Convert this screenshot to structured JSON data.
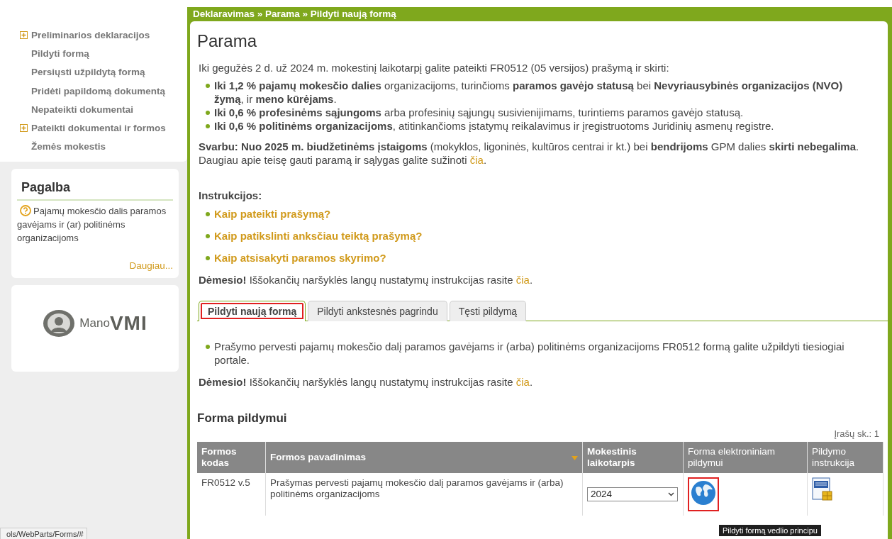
{
  "sidebar": {
    "menu": [
      {
        "label": "Preliminarios deklaracijos",
        "expandable": true
      },
      {
        "label": "Pildyti formą",
        "expandable": false
      },
      {
        "label": "Persiųsti užpildytą formą",
        "expandable": false
      },
      {
        "label": "Pridėti papildomą dokumentą",
        "expandable": false
      },
      {
        "label": "Nepateikti dokumentai",
        "expandable": false
      },
      {
        "label": "Pateikti dokumentai ir formos",
        "expandable": true
      },
      {
        "label": "Žemės mokestis",
        "expandable": false
      }
    ],
    "help": {
      "title": "Pagalba",
      "text": "Pajamų mokesčio dalis paramos gavėjams ir (ar) politinėms organizacijoms",
      "link": "Daugiau..."
    },
    "logo": {
      "word1": "Mano",
      "word2": "VMI"
    }
  },
  "breadcrumb": "Deklaravimas » Parama » Pildyti naują formą",
  "title": "Parama",
  "intro": "Iki gegužės 2 d. už 2024 m. mokestinį laikotarpį galite pateikti FR0512 (05 versijos) prašymą ir skirti:",
  "bullets": [
    "**Iki 1,2 % pajamų mokesčio dalies** organizacijoms, turinčioms **paramos gavėjo statusą** bei **Nevyriausybinės organizacijos (NVO) žymą**, ir **meno kūrėjams**.",
    "**Iki 0,6 % profesinėms sąjungoms** arba profesinių sąjungų susivienijimams, turintiems paramos gavėjo statusą.",
    "**Iki 0,6 % politinėms organizacijoms**, atitinkančioms įstatymų reikalavimus ir įregistruotoms Juridinių asmenų registre."
  ],
  "important": "**Svarbu: Nuo 2025 m. biudžetinėms įstaigoms** (mokyklos, ligoninės, kultūros centrai ir kt.) bei **bendrijoms** GPM dalies **skirti nebegalima**.",
  "more": {
    "text": "Daugiau apie teisę gauti paramą ir sąlygas galite sužinoti ",
    "link": "čia",
    "after": "."
  },
  "instructions": {
    "title": "Instrukcijos:",
    "links": [
      "Kaip pateikti prašymą?",
      "Kaip patikslinti anksčiau teiktą prašymą?",
      "Kaip atsisakyti paramos skyrimo?"
    ]
  },
  "notice": {
    "text": "**Dėmesio!** Iššokančių naršyklės langų nustatymų instrukcijas rasite ",
    "link": "čia",
    "after": "."
  },
  "tabs": [
    {
      "label": "Pildyti naują formą",
      "selected": true
    },
    {
      "label": "Pildyti ankstesnės pagrindu",
      "selected": false
    },
    {
      "label": "Tęsti pildymą",
      "selected": false
    }
  ],
  "tab_content": {
    "bullet": "Prašymo pervesti pajamų mokesčio dalį paramos gavėjams ir (arba) politinėms organizacijoms FR0512 formą galite užpildyti tiesiogiai portale.",
    "notice": {
      "text": "**Dėmesio!** Iššokančių naršyklės langų nustatymų instrukcijas rasite ",
      "link": "čia",
      "after": "."
    }
  },
  "section_title": "Forma pildymui",
  "record_count": "Įrašų sk.: 1",
  "table": {
    "columns": [
      {
        "label": "Formos kodas",
        "bold": true,
        "sorted": false
      },
      {
        "label": "Formos pavadinimas",
        "bold": true,
        "sorted": true
      },
      {
        "label": "Mokestinis laikotarpis",
        "bold": true,
        "sorted": false
      },
      {
        "label": "Forma elektroniniam pildymui",
        "bold": false,
        "sorted": false
      },
      {
        "label": "Pildymo instrukcija",
        "bold": false,
        "sorted": false
      }
    ],
    "rows": [
      {
        "code": "FR0512 v.5",
        "name": "Prašymas pervesti pajamų mokesčio dalį paramos gavėjams ir (arba) politinėms organizacijoms",
        "period": "2024"
      }
    ]
  },
  "tooltip": "Pildyti formą vedlio principu",
  "status_url": "ols/WebParts/Forms/#"
}
